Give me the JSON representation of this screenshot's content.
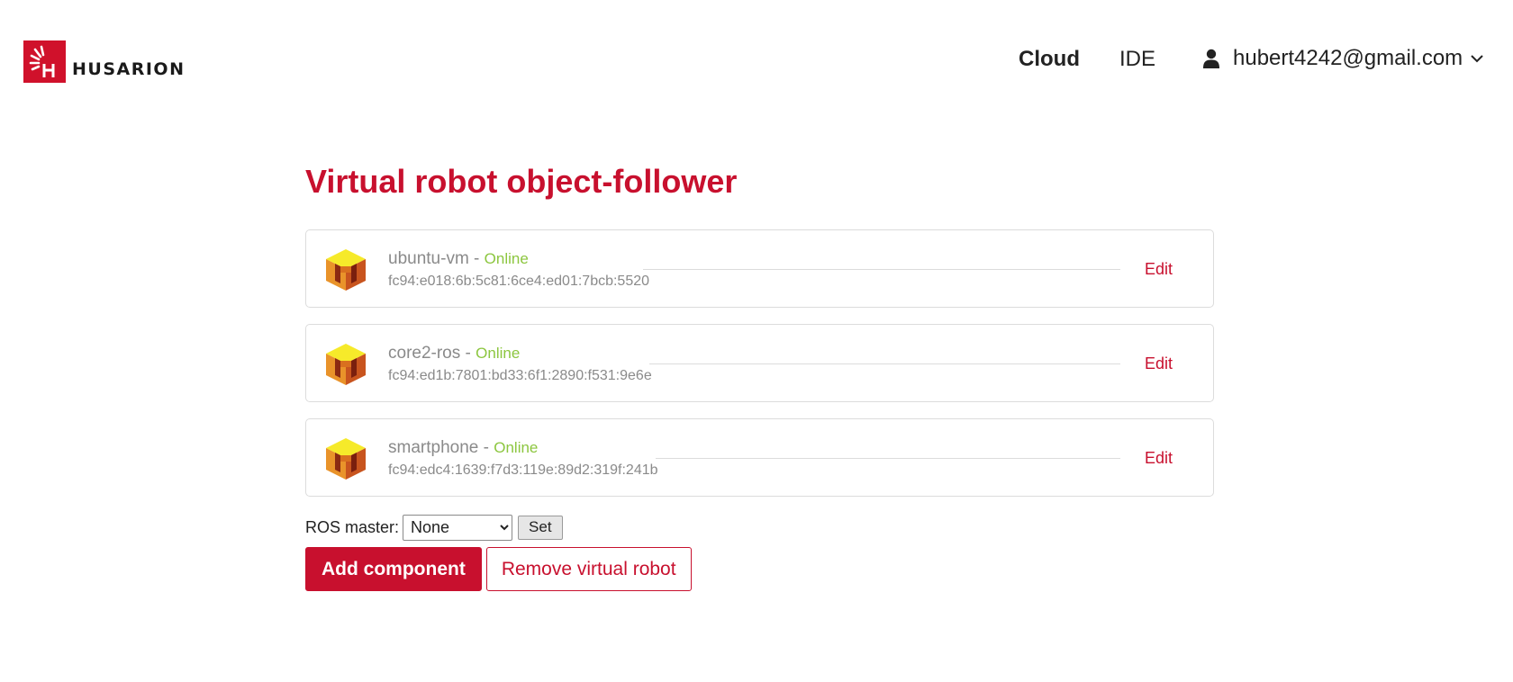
{
  "brand": {
    "logo_text": "HUSARION",
    "accent_color": "#c8102e"
  },
  "nav": {
    "cloud_label": "Cloud",
    "ide_label": "IDE",
    "user_email": "hubert4242@gmail.com",
    "user_icon": "user-icon",
    "menu_icon": "chevron-down-icon"
  },
  "page": {
    "title": "Virtual robot object-follower"
  },
  "devices": [
    {
      "name": "ubuntu-vm",
      "separator": " - ",
      "status": "Online",
      "address": "fc94:e018:6b:5c81:6ce4:ed01:7bcb:5520",
      "edit_label": "Edit",
      "icon": "cube-device-icon"
    },
    {
      "name": "core2-ros",
      "separator": " - ",
      "status": "Online",
      "address": "fc94:ed1b:7801:bd33:6f1:2890:f531:9e6e",
      "edit_label": "Edit",
      "icon": "cube-device-icon"
    },
    {
      "name": "smartphone",
      "separator": " - ",
      "status": "Online",
      "address": "fc94:edc4:1639:f7d3:119e:89d2:319f:241b",
      "edit_label": "Edit",
      "icon": "cube-device-icon"
    }
  ],
  "ros_master": {
    "label": "ROS master:",
    "selected": "None",
    "set_label": "Set"
  },
  "actions": {
    "add_component_label": "Add component",
    "remove_robot_label": "Remove virtual robot"
  }
}
